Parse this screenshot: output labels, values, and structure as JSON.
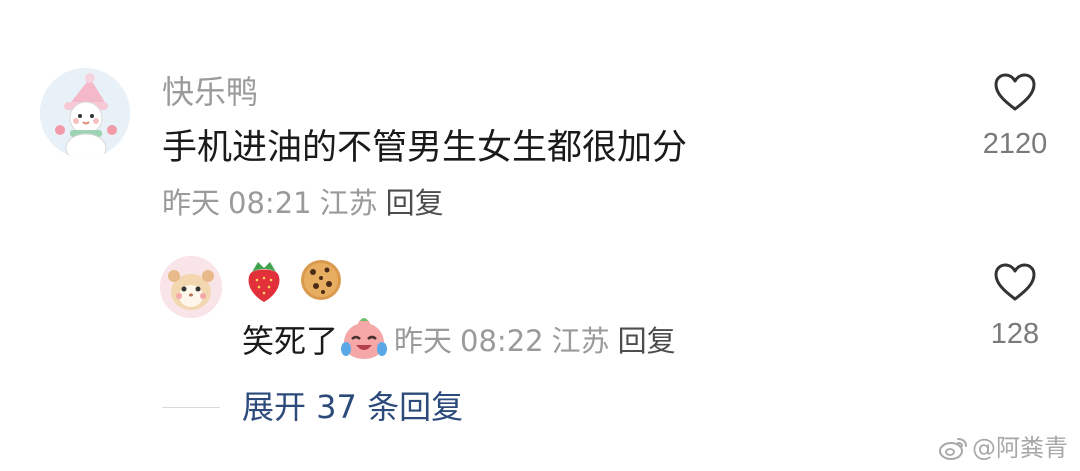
{
  "comment": {
    "username": "快乐鸭",
    "text": "手机进油的不管男生女生都很加分",
    "date": "昨天",
    "time": "08:21",
    "location": "江苏",
    "reply_label": "回复",
    "like_count": "2120",
    "avatar_icon": "snowman-avatar-icon"
  },
  "reply": {
    "emojis": [
      "strawberry-emoji",
      "cookie-emoji"
    ],
    "text": "笑死了",
    "inline_emoji": "laughing-crying-face-emoji",
    "date": "昨天",
    "time": "08:22",
    "location": "江苏",
    "reply_label": "回复",
    "like_count": "128",
    "avatar_icon": "hamster-avatar-icon"
  },
  "expand": {
    "label": "展开 37 条回复"
  },
  "watermark": {
    "text": "@阿粪青",
    "icon": "weibo-logo-icon"
  },
  "colors": {
    "username": "#9a9a9a",
    "meta": "#9a9a9a",
    "expand_link": "#2c4a7a",
    "heart": "#333333"
  }
}
